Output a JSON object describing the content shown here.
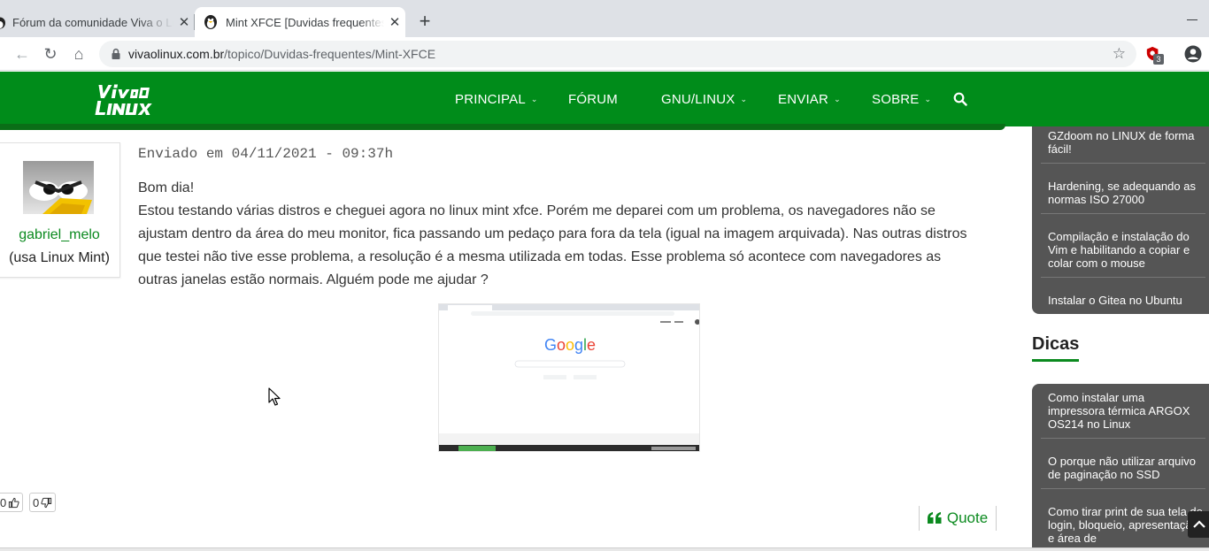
{
  "browser": {
    "tabs": [
      {
        "title": "Fórum da comunidade Viva o Linux",
        "active": false
      },
      {
        "title": "Mint XFCE [Duvidas frequentes]",
        "active": true
      }
    ],
    "tab_close": "✕",
    "new_tab": "+",
    "nav": {
      "back": "←",
      "forward": "→",
      "reload": "↻",
      "home": "⌂"
    },
    "url_domain": "vivaolinux.com.br",
    "url_path": "/topico/Duvidas-frequentes/Mint-XFCE",
    "bookmark_star": "☆",
    "extension_badge": "3"
  },
  "site": {
    "colors": {
      "header": "#008c1a",
      "accent": "#0b8a1f",
      "sidebar": "#555555"
    },
    "menu": [
      {
        "label": "PRINCIPAL",
        "dropdown": true
      },
      {
        "label": "FÓRUM",
        "dropdown": false
      },
      {
        "label": "GNU/LINUX",
        "dropdown": true
      },
      {
        "label": "ENVIAR",
        "dropdown": true
      },
      {
        "label": "SOBRE",
        "dropdown": true
      }
    ],
    "chevron": "⌄"
  },
  "post": {
    "author": "gabriel_melo",
    "author_os": "(usa Linux Mint)",
    "date": "Enviado em 04/11/2021 - 09:37h",
    "greeting": "Bom dia!",
    "body": "Estou testando várias distros e cheguei agora no linux mint xfce. Porém me deparei com um problema, os navegadores não se ajustam dentro da área do meu monitor, fica passando um pedaço para fora da tela (igual na imagem arquivada). Nas outras distros que testei não tive esse problema, a resolução é a mesma utilizada em todas. Esse problema só acontece com navegadores as outras janelas estão normais. Alguém pode me ajudar ?",
    "image_brand": "Google",
    "upvotes": "0",
    "downvotes": "0",
    "quote_label": "Quote"
  },
  "sidebar": {
    "articles": [
      "GZdoom no LINUX de forma fácil!",
      "Hardening, se adequando as normas ISO 27000",
      "Compilação e instalação do Vim e habilitando a copiar e colar com o mouse",
      "Instalar o Gitea no Ubuntu"
    ],
    "dicas_title": "Dicas",
    "dicas": [
      "Como instalar uma impressora térmica ARGOX OS214 no Linux",
      "O porque não utilizar arquivo de paginação no SSD",
      "Como tirar print de sua tela de login, bloqueio, apresentação e área de"
    ]
  }
}
